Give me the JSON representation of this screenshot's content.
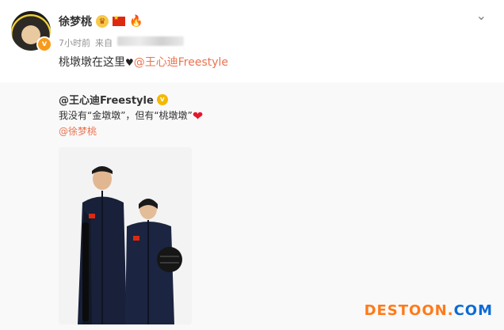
{
  "post": {
    "author": "徐梦桃",
    "time": "7小时前",
    "source_prefix": "来自",
    "content_text": "桃墩墩在这里",
    "mention": "@王心迪Freestyle",
    "v_mark": "v"
  },
  "repost": {
    "author": "@王心迪Freestyle",
    "text": "我没有“金墩墩”，但有“桃墩墩”",
    "mention": "@徐梦桃",
    "v_mark": "v"
  },
  "watermark": {
    "part1": "DESTOON",
    "dot": ".",
    "part2": "COM"
  },
  "icons": [
    "crown-badge-icon",
    "china-flag-icon",
    "fire-icon",
    "chevron-down-icon",
    "black-heart-icon",
    "red-heart-icon",
    "verified-icon"
  ],
  "colors": {
    "mention": "#eb7350",
    "repost_bg": "#f9f9f9",
    "verified": "#f5b800"
  }
}
